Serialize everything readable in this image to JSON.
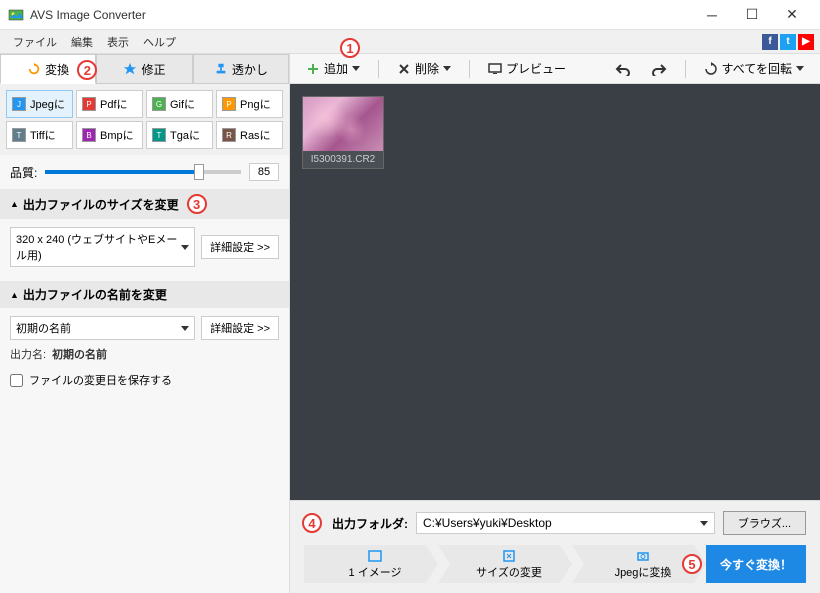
{
  "window": {
    "title": "AVS Image Converter"
  },
  "menu": {
    "file": "ファイル",
    "edit": "編集",
    "view": "表示",
    "help": "ヘルプ"
  },
  "tabs": {
    "convert": "変換",
    "correct": "修正",
    "watermark": "透かし"
  },
  "formats": {
    "jpeg": "Jpegに",
    "pdf": "Pdfに",
    "gif": "Gifに",
    "png": "Pngに",
    "tiff": "Tiffに",
    "bmp": "Bmpに",
    "tga": "Tgaに",
    "ras": "Rasに"
  },
  "quality": {
    "label": "品質:",
    "value": "85"
  },
  "resize": {
    "header": "出力ファイルのサイズを変更",
    "preset": "320 x 240 (ウェブサイトやEメール用)",
    "advanced": "詳細設定 >>"
  },
  "rename": {
    "header": "出力ファイルの名前を変更",
    "preset": "初期の名前",
    "advanced": "詳細設定 >>",
    "output_label": "出力名:",
    "output_value": "初期の名前",
    "keep_date": "ファイルの変更日を保存する"
  },
  "toolbar": {
    "add": "追加",
    "remove": "削除",
    "preview": "プレビュー",
    "rotate_all": "すべてを回転"
  },
  "thumb": {
    "filename": "I5300391.CR2"
  },
  "output": {
    "label": "出力フォルダ:",
    "path": "C:¥Users¥yuki¥Desktop",
    "browse": "ブラウズ..."
  },
  "steps": {
    "s1": "1 イメージ",
    "s2": "サイズの変更",
    "s3": "Jpegに変換"
  },
  "convert_button": "今すぐ変換！",
  "annotations": {
    "a1": "1",
    "a2": "2",
    "a3": "3",
    "a4": "4",
    "a5": "5"
  }
}
